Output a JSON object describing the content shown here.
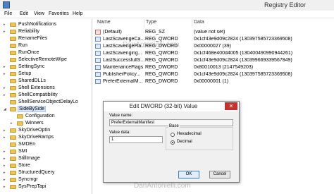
{
  "window": {
    "title": "Registry Editor"
  },
  "menu": [
    "File",
    "Edit",
    "View",
    "Favorites",
    "Help"
  ],
  "tree": {
    "items": [
      {
        "label": "PushNotifications",
        "expander": "▸",
        "indent": 0
      },
      {
        "label": "Reliability",
        "expander": "▸",
        "indent": 0
      },
      {
        "label": "RenameFiles",
        "expander": "",
        "indent": 0
      },
      {
        "label": "Run",
        "expander": "",
        "indent": 0
      },
      {
        "label": "RunOnce",
        "expander": "",
        "indent": 0
      },
      {
        "label": "SelectiveRemoteWipe",
        "expander": "",
        "indent": 0
      },
      {
        "label": "SettingSync",
        "expander": "▸",
        "indent": 0
      },
      {
        "label": "Setup",
        "expander": "▸",
        "indent": 0
      },
      {
        "label": "SharedDLLs",
        "expander": "",
        "indent": 0
      },
      {
        "label": "Shell Extensions",
        "expander": "▸",
        "indent": 0
      },
      {
        "label": "ShellCompatibility",
        "expander": "▸",
        "indent": 0
      },
      {
        "label": "ShellServiceObjectDelayLo",
        "expander": "",
        "indent": 0
      },
      {
        "label": "SideBySide",
        "expander": "◢",
        "indent": 0,
        "selected": true
      },
      {
        "label": "Configuration",
        "expander": "",
        "indent": 1
      },
      {
        "label": "Winners",
        "expander": "▸",
        "indent": 1
      },
      {
        "label": "SkyDriveOptIn",
        "expander": "▸",
        "indent": 0
      },
      {
        "label": "SkyDriveRamps",
        "expander": "▸",
        "indent": 0
      },
      {
        "label": "SMDEn",
        "expander": "",
        "indent": 0
      },
      {
        "label": "SMI",
        "expander": "▸",
        "indent": 0
      },
      {
        "label": "StillImage",
        "expander": "▸",
        "indent": 0
      },
      {
        "label": "Store",
        "expander": "▸",
        "indent": 0
      },
      {
        "label": "StructuredQuery",
        "expander": "▸",
        "indent": 0
      },
      {
        "label": "Syncmgr",
        "expander": "▸",
        "indent": 0
      },
      {
        "label": "SysPrepTapi",
        "expander": "▸",
        "indent": 0
      }
    ]
  },
  "values_table": {
    "columns": [
      "Name",
      "Type",
      "Data"
    ],
    "rows": [
      {
        "name": "(Default)",
        "type": "REG_SZ",
        "data": "(value not set)",
        "kind": "sz"
      },
      {
        "name": "LastScavengeCa...",
        "type": "REG_QWORD",
        "data": "0x1cf43e9d09c2824 (130397585723369508)",
        "kind": "bin"
      },
      {
        "name": "LastScavengeFla...",
        "type": "REG_DWORD",
        "data": "0x00000027 (39)",
        "kind": "bin"
      },
      {
        "name": "LastScavenging...",
        "type": "REG_QWORD",
        "data": "0x1cf468e400d4005 (130400490990944261)",
        "kind": "bin"
      },
      {
        "name": "LastSuccessfullS...",
        "type": "REG_QWORD",
        "data": "0x1cf43e9d09c2824 (130399669339567849)",
        "kind": "bin"
      },
      {
        "name": "MaintenanceFlags",
        "type": "REG_DWORD",
        "data": "0x80010013 (2147549203)",
        "kind": "bin"
      },
      {
        "name": "PublisherPolicy...",
        "type": "REG_QWORD",
        "data": "0x1cf43e9d09c2824 (130397585723369508)",
        "kind": "bin"
      },
      {
        "name": "PreferExternalM...",
        "type": "REG_DWORD",
        "data": "0x00000001 (1)",
        "kind": "bin"
      }
    ]
  },
  "dialog": {
    "title": "Edit DWORD (32-bit) Value",
    "close_glyph": "✕",
    "value_name_label": "Value name:",
    "value_name": "PreferExternalManifest",
    "value_data_label": "Value data:",
    "value_data": "1",
    "base_label": "Base",
    "hex_label": "Hexadecimal",
    "dec_label": "Decimal",
    "selected_base": "Decimal",
    "ok_label": "OK",
    "cancel_label": "Cancel"
  },
  "watermarks": {
    "top": "DanAntonielli.com",
    "bottom": "DanAntonielli.com"
  }
}
